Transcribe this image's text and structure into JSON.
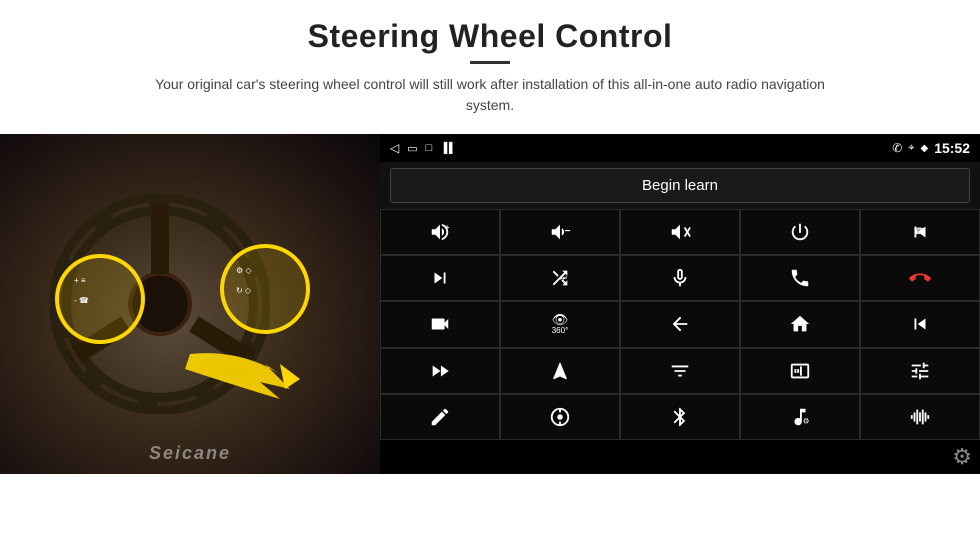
{
  "header": {
    "title": "Steering Wheel Control",
    "divider": true,
    "subtitle": "Your original car's steering wheel control will still work after installation of this all-in-one auto radio navigation system."
  },
  "status_bar": {
    "back_icon": "◁",
    "home_icon": "▭",
    "square_icon": "□",
    "signal_icon": "▐▐",
    "phone_icon": "✆",
    "location_icon": "⌖",
    "wifi_icon": "◆",
    "time": "15:52"
  },
  "begin_learn": {
    "label": "Begin learn"
  },
  "icon_grid": [
    {
      "id": "vol-up",
      "symbol": "🔊+"
    },
    {
      "id": "vol-down",
      "symbol": "🔉−"
    },
    {
      "id": "mute",
      "symbol": "🔇×"
    },
    {
      "id": "power",
      "symbol": "⏻"
    },
    {
      "id": "prev-track",
      "symbol": "⏮"
    },
    {
      "id": "next-track",
      "symbol": "⏭"
    },
    {
      "id": "shuffle",
      "symbol": "⇌⏭"
    },
    {
      "id": "mic",
      "symbol": "🎤"
    },
    {
      "id": "phone",
      "symbol": "📞"
    },
    {
      "id": "hang-up",
      "symbol": "📵"
    },
    {
      "id": "camera",
      "symbol": "📷"
    },
    {
      "id": "360-view",
      "symbol": "360°"
    },
    {
      "id": "back",
      "symbol": "↩"
    },
    {
      "id": "home",
      "symbol": "⌂"
    },
    {
      "id": "skip-back",
      "symbol": "⏮⏮"
    },
    {
      "id": "fast-forward",
      "symbol": "⏭⏭"
    },
    {
      "id": "navigate",
      "symbol": "▶"
    },
    {
      "id": "settings-eq",
      "symbol": "⇌"
    },
    {
      "id": "media",
      "symbol": "📻"
    },
    {
      "id": "equalizer",
      "symbol": "⫷⫷"
    },
    {
      "id": "pen",
      "symbol": "✏"
    },
    {
      "id": "dashboard",
      "symbol": "⊙"
    },
    {
      "id": "bluetooth",
      "symbol": "⚡"
    },
    {
      "id": "music",
      "symbol": "♪"
    },
    {
      "id": "waveform",
      "symbol": "⫼⫼⫼"
    }
  ],
  "bottom_bar": {
    "gear_icon": "⚙"
  },
  "seicane_logo": "Seicane"
}
